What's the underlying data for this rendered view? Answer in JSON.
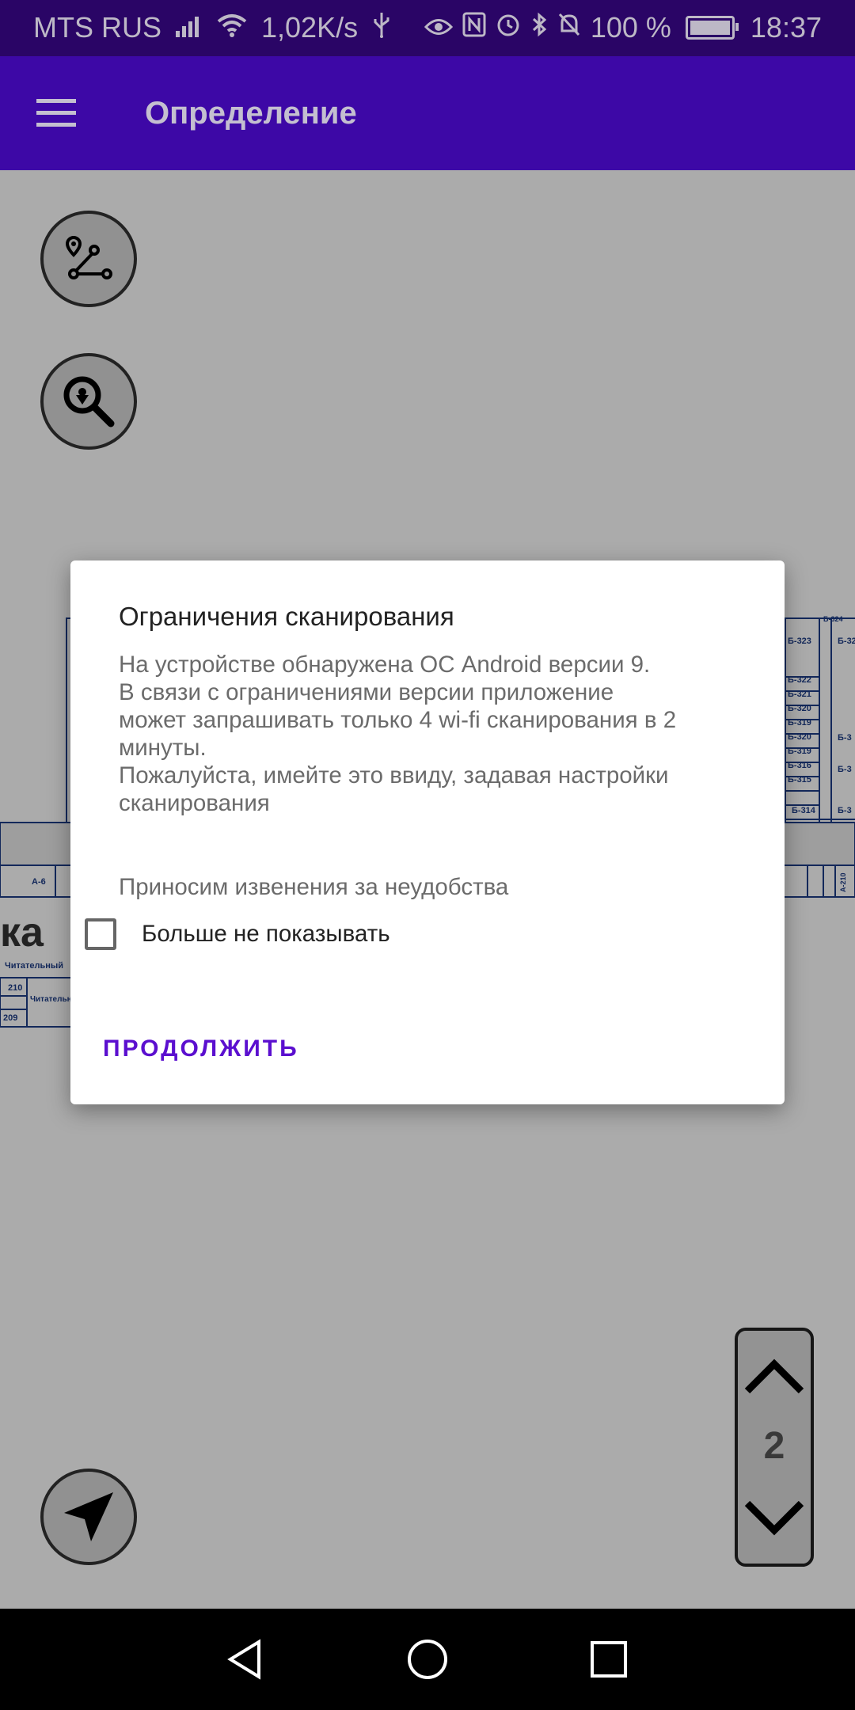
{
  "status_bar": {
    "carrier": "MTS RUS",
    "network_speed": "1,02K/s",
    "battery_percent": "100 %",
    "time": "18:37"
  },
  "app_bar": {
    "title": "Определение"
  },
  "map": {
    "rooms": [
      "Б-323",
      "Б-32",
      "Б-324",
      "Б-322",
      "Б-321",
      "Б-320",
      "Б-319",
      "Б-320",
      "Б-319",
      "Б-316",
      "Б-315",
      "Б-314",
      "Б-3",
      "Б-3",
      "Б-3",
      "А-6",
      "А-210",
      "ка",
      "Читательный",
      "210",
      "Читательный зал",
      "209"
    ],
    "floor": "2"
  },
  "dialog": {
    "title": "Ограничения сканирования",
    "body_lines": [
      "На устройстве обнаружена ОС Android версии 9.",
      "В связи с ограничениями версии приложение",
      "может запрашивать только 4 wi-fi сканирования в 2",
      "минуты.",
      "Пожалуйста, имейте это ввиду, задавая настройки",
      "сканирования"
    ],
    "apology": "Приносим извенения за неудобства",
    "checkbox_label": "Больше не показывать",
    "checkbox_checked": false,
    "continue_button": "ПРОДОЛЖИТЬ"
  },
  "colors": {
    "status_bar": "#2a0566",
    "app_bar": "#3d08a6",
    "accent": "#5b0fcf",
    "map_lines": "#1d3d86"
  },
  "icons": [
    "menu-icon",
    "route-icon",
    "search-location-icon",
    "navigation-arrow-icon",
    "chevron-up-icon",
    "chevron-down-icon",
    "nav-back-icon",
    "nav-home-icon",
    "nav-recents-icon"
  ]
}
